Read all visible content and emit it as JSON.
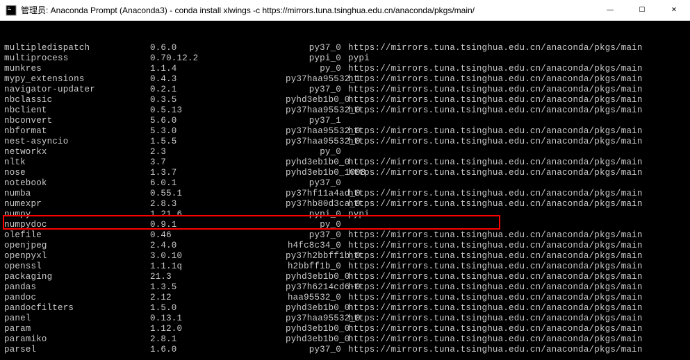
{
  "window": {
    "title": "管理员: Anaconda Prompt (Anaconda3) - conda  install xlwings -c https://mirrors.tuna.tsinghua.edu.cn/anaconda/pkgs/main/"
  },
  "controls": {
    "minimize": "—",
    "maximize": "☐",
    "close": "✕"
  },
  "channel_url": "https://mirrors.tuna.tsinghua.edu.cn/anaconda/pkgs/main",
  "highlighted_index": 17,
  "packages": [
    {
      "name": "multipledispatch",
      "version": "0.6.0",
      "build": "py37_0",
      "channel": "https://mirrors.tuna.tsinghua.edu.cn/anaconda/pkgs/main"
    },
    {
      "name": "multiprocess",
      "version": "0.70.12.2",
      "build": "pypi_0",
      "channel": "pypi"
    },
    {
      "name": "munkres",
      "version": "1.1.4",
      "build": "py_0",
      "channel": "https://mirrors.tuna.tsinghua.edu.cn/anaconda/pkgs/main"
    },
    {
      "name": "mypy_extensions",
      "version": "0.4.3",
      "build": "py37haa95532_1",
      "channel": "https://mirrors.tuna.tsinghua.edu.cn/anaconda/pkgs/main"
    },
    {
      "name": "navigator-updater",
      "version": "0.2.1",
      "build": "py37_0",
      "channel": "https://mirrors.tuna.tsinghua.edu.cn/anaconda/pkgs/main"
    },
    {
      "name": "nbclassic",
      "version": "0.3.5",
      "build": "pyhd3eb1b0_0",
      "channel": "https://mirrors.tuna.tsinghua.edu.cn/anaconda/pkgs/main"
    },
    {
      "name": "nbclient",
      "version": "0.5.13",
      "build": "py37haa95532_0",
      "channel": "https://mirrors.tuna.tsinghua.edu.cn/anaconda/pkgs/main"
    },
    {
      "name": "nbconvert",
      "version": "5.6.0",
      "build": "py37_1",
      "channel": ""
    },
    {
      "name": "nbformat",
      "version": "5.3.0",
      "build": "py37haa95532_0",
      "channel": "https://mirrors.tuna.tsinghua.edu.cn/anaconda/pkgs/main"
    },
    {
      "name": "nest-asyncio",
      "version": "1.5.5",
      "build": "py37haa95532_0",
      "channel": "https://mirrors.tuna.tsinghua.edu.cn/anaconda/pkgs/main"
    },
    {
      "name": "networkx",
      "version": "2.3",
      "build": "py_0",
      "channel": ""
    },
    {
      "name": "nltk",
      "version": "3.7",
      "build": "pyhd3eb1b0_0",
      "channel": "https://mirrors.tuna.tsinghua.edu.cn/anaconda/pkgs/main"
    },
    {
      "name": "nose",
      "version": "1.3.7",
      "build": "pyhd3eb1b0_1008",
      "channel": "https://mirrors.tuna.tsinghua.edu.cn/anaconda/pkgs/main"
    },
    {
      "name": "notebook",
      "version": "6.0.1",
      "build": "py37_0",
      "channel": ""
    },
    {
      "name": "numba",
      "version": "0.55.1",
      "build": "py37hf11a4ad_0",
      "channel": "https://mirrors.tuna.tsinghua.edu.cn/anaconda/pkgs/main"
    },
    {
      "name": "numexpr",
      "version": "2.8.3",
      "build": "py37hb80d3ca_0",
      "channel": "https://mirrors.tuna.tsinghua.edu.cn/anaconda/pkgs/main"
    },
    {
      "name": "numpy",
      "version": "1.21.6",
      "build": "pypi_0",
      "channel": "pypi"
    },
    {
      "name": "numpydoc",
      "version": "0.9.1",
      "build": "py_0",
      "channel": ""
    },
    {
      "name": "olefile",
      "version": "0.46",
      "build": "py37_0",
      "channel": "https://mirrors.tuna.tsinghua.edu.cn/anaconda/pkgs/main"
    },
    {
      "name": "openjpeg",
      "version": "2.4.0",
      "build": "h4fc8c34_0",
      "channel": "https://mirrors.tuna.tsinghua.edu.cn/anaconda/pkgs/main"
    },
    {
      "name": "openpyxl",
      "version": "3.0.10",
      "build": "py37h2bbff1b_0",
      "channel": "https://mirrors.tuna.tsinghua.edu.cn/anaconda/pkgs/main"
    },
    {
      "name": "openssl",
      "version": "1.1.1q",
      "build": "h2bbff1b_0",
      "channel": "https://mirrors.tuna.tsinghua.edu.cn/anaconda/pkgs/main"
    },
    {
      "name": "packaging",
      "version": "21.3",
      "build": "pyhd3eb1b0_0",
      "channel": "https://mirrors.tuna.tsinghua.edu.cn/anaconda/pkgs/main"
    },
    {
      "name": "pandas",
      "version": "1.3.5",
      "build": "py37h6214cd6-0",
      "channel": "https://mirrors.tuna.tsinghua.edu.cn/anaconda/pkgs/main"
    },
    {
      "name": "pandoc",
      "version": "2.12",
      "build": "haa95532_0",
      "channel": "https://mirrors.tuna.tsinghua.edu.cn/anaconda/pkgs/main"
    },
    {
      "name": "pandocfilters",
      "version": "1.5.0",
      "build": "pyhd3eb1b0_0",
      "channel": "https://mirrors.tuna.tsinghua.edu.cn/anaconda/pkgs/main"
    },
    {
      "name": "panel",
      "version": "0.13.1",
      "build": "py37haa95532_0",
      "channel": "https://mirrors.tuna.tsinghua.edu.cn/anaconda/pkgs/main"
    },
    {
      "name": "param",
      "version": "1.12.0",
      "build": "pyhd3eb1b0_0",
      "channel": "https://mirrors.tuna.tsinghua.edu.cn/anaconda/pkgs/main"
    },
    {
      "name": "paramiko",
      "version": "2.8.1",
      "build": "pyhd3eb1b0_0",
      "channel": "https://mirrors.tuna.tsinghua.edu.cn/anaconda/pkgs/main"
    },
    {
      "name": "parsel",
      "version": "1.6.0",
      "build": "py37_0",
      "channel": "https://mirrors.tuna.tsinghua.edu.cn/anaconda/pkgs/main"
    }
  ]
}
